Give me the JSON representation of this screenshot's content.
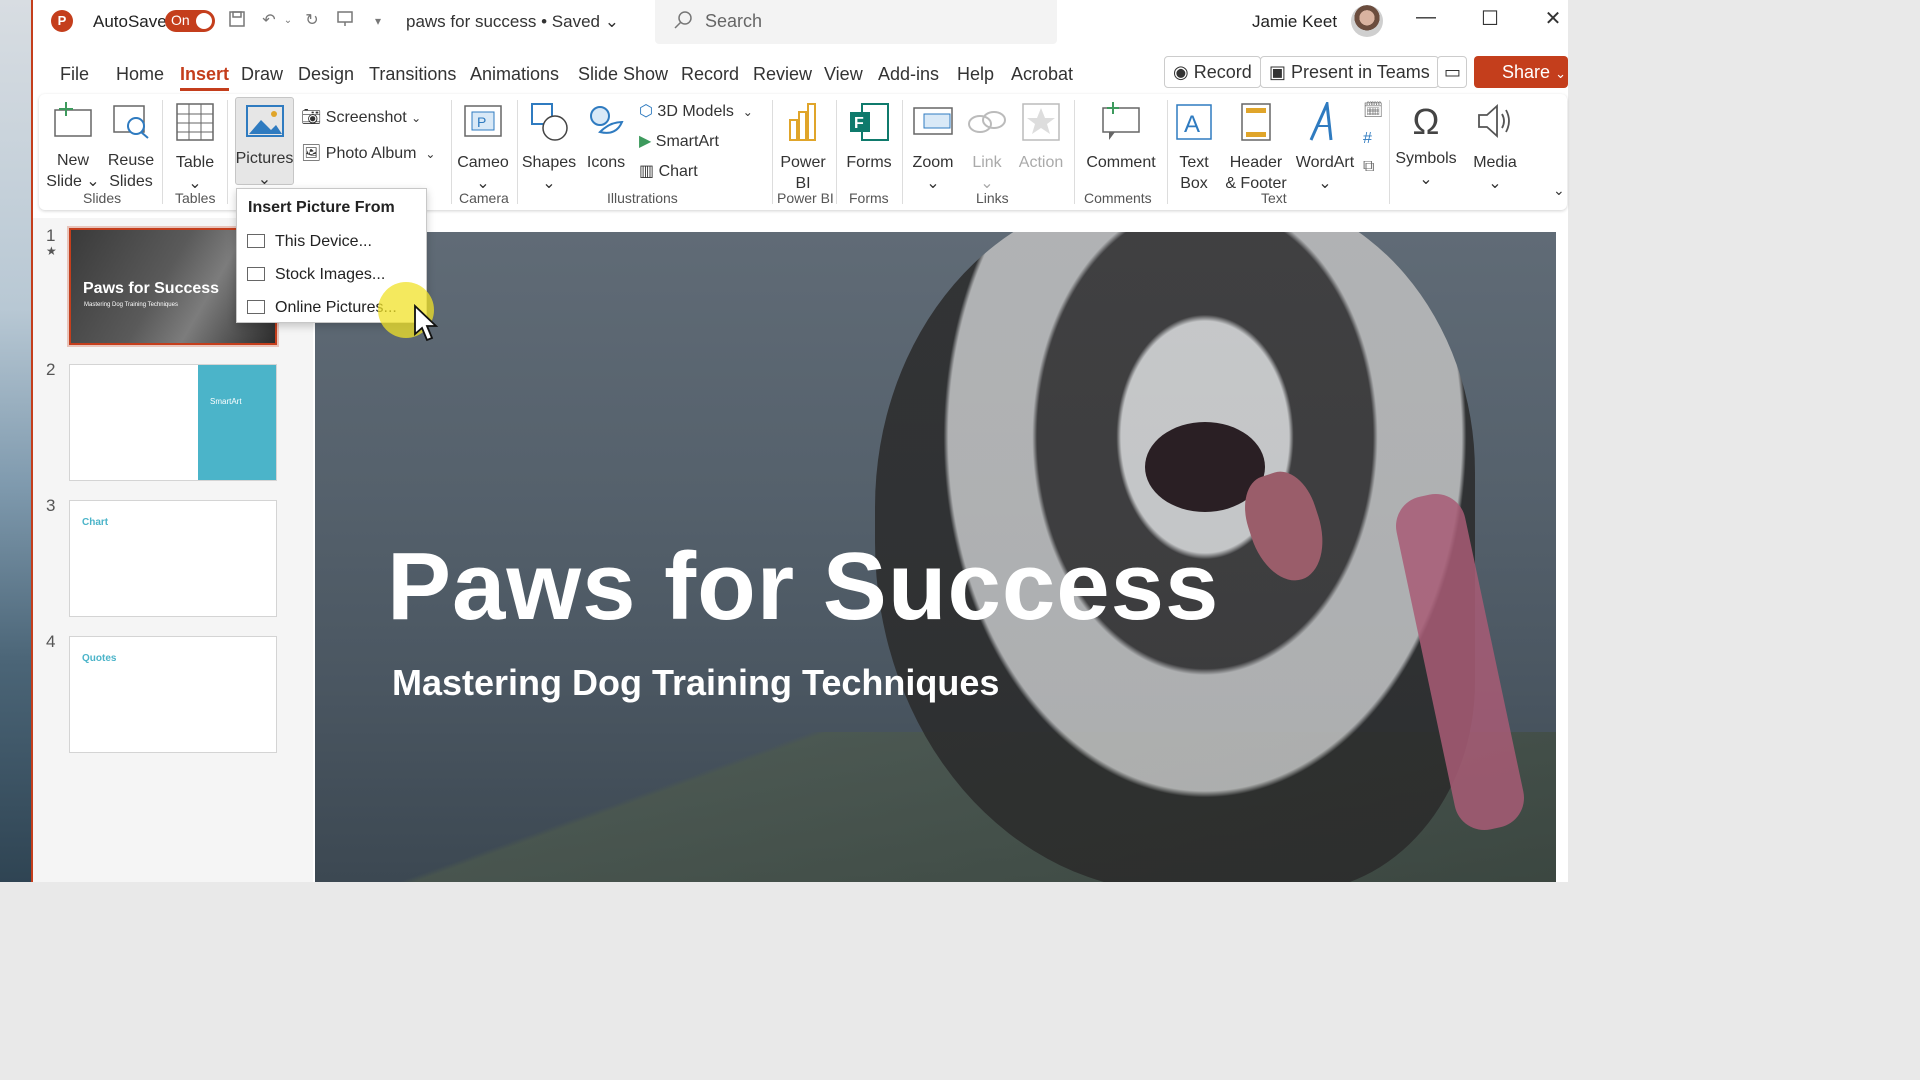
{
  "titlebar": {
    "autosave_label": "AutoSave",
    "autosave_state": "On",
    "doc_title": "paws for success • Saved",
    "search_placeholder": "Search",
    "user_name": "Jamie Keet"
  },
  "tabs": [
    "File",
    "Home",
    "Insert",
    "Draw",
    "Design",
    "Transitions",
    "Animations",
    "Slide Show",
    "Record",
    "Review",
    "View",
    "Add-ins",
    "Help",
    "Acrobat"
  ],
  "active_tab": "Insert",
  "actions": {
    "record": "Record",
    "present_in_teams": "Present in Teams",
    "share": "Share"
  },
  "ribbon": {
    "new_slide": [
      "New",
      "Slide"
    ],
    "reuse_slides": [
      "Reuse",
      "Slides"
    ],
    "table": "Table",
    "pictures": "Pictures",
    "screenshot": "Screenshot",
    "photo_album": "Photo Album",
    "cameo": "Cameo",
    "shapes": "Shapes",
    "icons": "Icons",
    "models_3d": "3D Models",
    "smartart": "SmartArt",
    "chart": "Chart",
    "power_bi": [
      "Power",
      "BI"
    ],
    "forms": "Forms",
    "zoom": "Zoom",
    "link": "Link",
    "action": "Action",
    "comment": "Comment",
    "text_box": [
      "Text",
      "Box"
    ],
    "header_footer": [
      "Header",
      "& Footer"
    ],
    "wordart": "WordArt",
    "symbols": "Symbols",
    "media": "Media",
    "groups": {
      "slides": "Slides",
      "tables": "Tables",
      "camera": "Camera",
      "illustrations": "Illustrations",
      "power_bi": "Power BI",
      "forms": "Forms",
      "links": "Links",
      "comments": "Comments",
      "text": "Text"
    }
  },
  "dropdown": {
    "header": "Insert Picture From",
    "items": [
      "This Device...",
      "Stock Images...",
      "Online Pictures..."
    ]
  },
  "thumbnails": [
    {
      "number": "1",
      "title": "Paws for Success",
      "subtitle": "Mastering Dog Training Techniques"
    },
    {
      "number": "2",
      "label": "SmartArt"
    },
    {
      "number": "3",
      "label": "Chart"
    },
    {
      "number": "4",
      "label": "Quotes"
    }
  ],
  "slide": {
    "title": "Paws for Success",
    "subtitle": "Mastering Dog Training Techniques"
  },
  "colors": {
    "accent": "#c43e1c",
    "teal": "#4bb4c9"
  }
}
